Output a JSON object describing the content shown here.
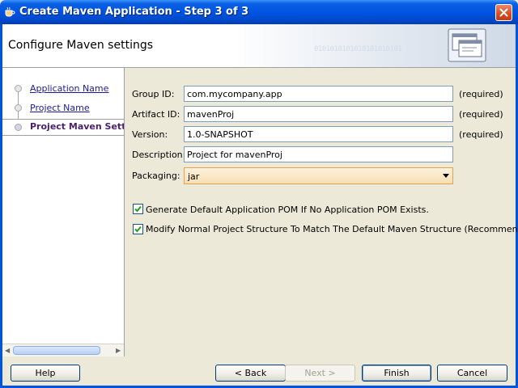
{
  "window": {
    "title": "Create Maven Application - Step 3 of 3"
  },
  "header": {
    "title": "Configure Maven settings",
    "binary_watermark": "0101010101010101010101"
  },
  "nav": {
    "items": [
      {
        "label": "Application Name"
      },
      {
        "label": "Project Name"
      },
      {
        "label": "Project Maven Settin"
      }
    ]
  },
  "form": {
    "group_id": {
      "label": "Group ID:",
      "value": "com.mycompany.app",
      "hint": "(required)"
    },
    "artifact_id": {
      "label": "Artifact ID:",
      "value": "mavenProj",
      "hint": "(required)"
    },
    "version": {
      "label": "Version:",
      "value": "1.0-SNAPSHOT",
      "hint": "(required)"
    },
    "description": {
      "label": "Description:",
      "value": "Project for mavenProj"
    },
    "packaging": {
      "label": "Packaging:",
      "value": "jar"
    }
  },
  "options": {
    "generate_pom": {
      "label": "Generate Default Application POM If No Application POM Exists.",
      "checked": true
    },
    "modify_structure": {
      "label": "Modify Normal Project Structure To Match The Default Maven Structure (Recommended)",
      "checked": true
    }
  },
  "buttons": {
    "help": "Help",
    "back": "< Back",
    "next": "Next >",
    "finish": "Finish",
    "cancel": "Cancel"
  },
  "colors": {
    "title_bar": "#0054e3",
    "link": "#1d1a99",
    "current_step": "#4a1f6e",
    "dropdown_focus": "#e5a24e"
  }
}
